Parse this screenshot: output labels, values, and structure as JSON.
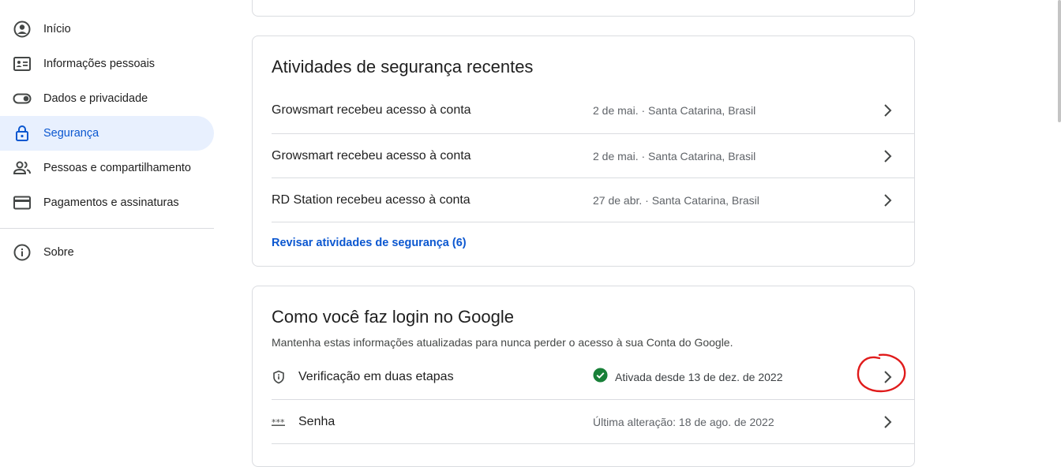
{
  "sidebar": {
    "items": [
      {
        "label": "Início",
        "icon": "account-circle-icon"
      },
      {
        "label": "Informações pessoais",
        "icon": "id-card-icon"
      },
      {
        "label": "Dados e privacidade",
        "icon": "toggle-icon"
      },
      {
        "label": "Segurança",
        "icon": "lock-icon",
        "active": true
      },
      {
        "label": "Pessoas e compartilhamento",
        "icon": "people-icon"
      },
      {
        "label": "Pagamentos e assinaturas",
        "icon": "credit-card-icon"
      }
    ],
    "about": {
      "label": "Sobre",
      "icon": "info-icon"
    }
  },
  "activity": {
    "title": "Atividades de segurança recentes",
    "rows": [
      {
        "title": "Growsmart recebeu acesso à conta",
        "meta": "2 de mai. · Santa Catarina, Brasil"
      },
      {
        "title": "Growsmart recebeu acesso à conta",
        "meta": "2 de mai. · Santa Catarina, Brasil"
      },
      {
        "title": "RD Station recebeu acesso à conta",
        "meta": "27 de abr. · Santa Catarina, Brasil"
      }
    ],
    "review_link": "Revisar atividades de segurança (6)"
  },
  "login": {
    "title": "Como você faz login no Google",
    "subtitle": "Mantenha estas informações atualizadas para nunca perder o acesso à sua Conta do Google.",
    "rows": [
      {
        "title": "Verificação em duas etapas",
        "icon": "shield-icon",
        "status": "Ativada desde 13 de dez. de 2022",
        "status_icon": "check-circle-icon"
      },
      {
        "title": "Senha",
        "icon": "password-dots-icon",
        "meta": "Última alteração: 18 de ago. de 2022"
      }
    ]
  },
  "colors": {
    "accent": "#0b57d0",
    "active_bg": "#e8f0fe",
    "success": "#188038",
    "annotation": "#e01b1b"
  }
}
